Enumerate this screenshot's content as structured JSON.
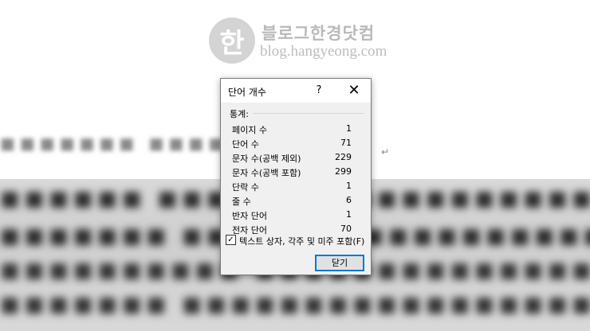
{
  "watermark": {
    "seal": "한",
    "title": "블로그한경닷컴",
    "url": "blog.hangyeong.com"
  },
  "dialog": {
    "title": "단어 개수",
    "help_label": "?",
    "close_icon": "✕",
    "group_label": "통계:",
    "stats": [
      {
        "label": "페이지 수",
        "value": "1"
      },
      {
        "label": "단어 수",
        "value": "71"
      },
      {
        "label": "문자 수(공백 제외)",
        "value": "229"
      },
      {
        "label": "문자 수(공백 포함)",
        "value": "299"
      },
      {
        "label": "단락 수",
        "value": "1"
      },
      {
        "label": "줄 수",
        "value": "6"
      },
      {
        "label": "반자 단어",
        "value": "1"
      },
      {
        "label": "전자 단어",
        "value": "70"
      }
    ],
    "checkbox": {
      "label": "텍스트 상자, 각주 및 미주 포함(F)",
      "checked_mark": "✓"
    },
    "close_button": "닫기"
  },
  "colors": {
    "dialog_bg": "#f0f0f0",
    "accent_border": "#0078d7"
  }
}
